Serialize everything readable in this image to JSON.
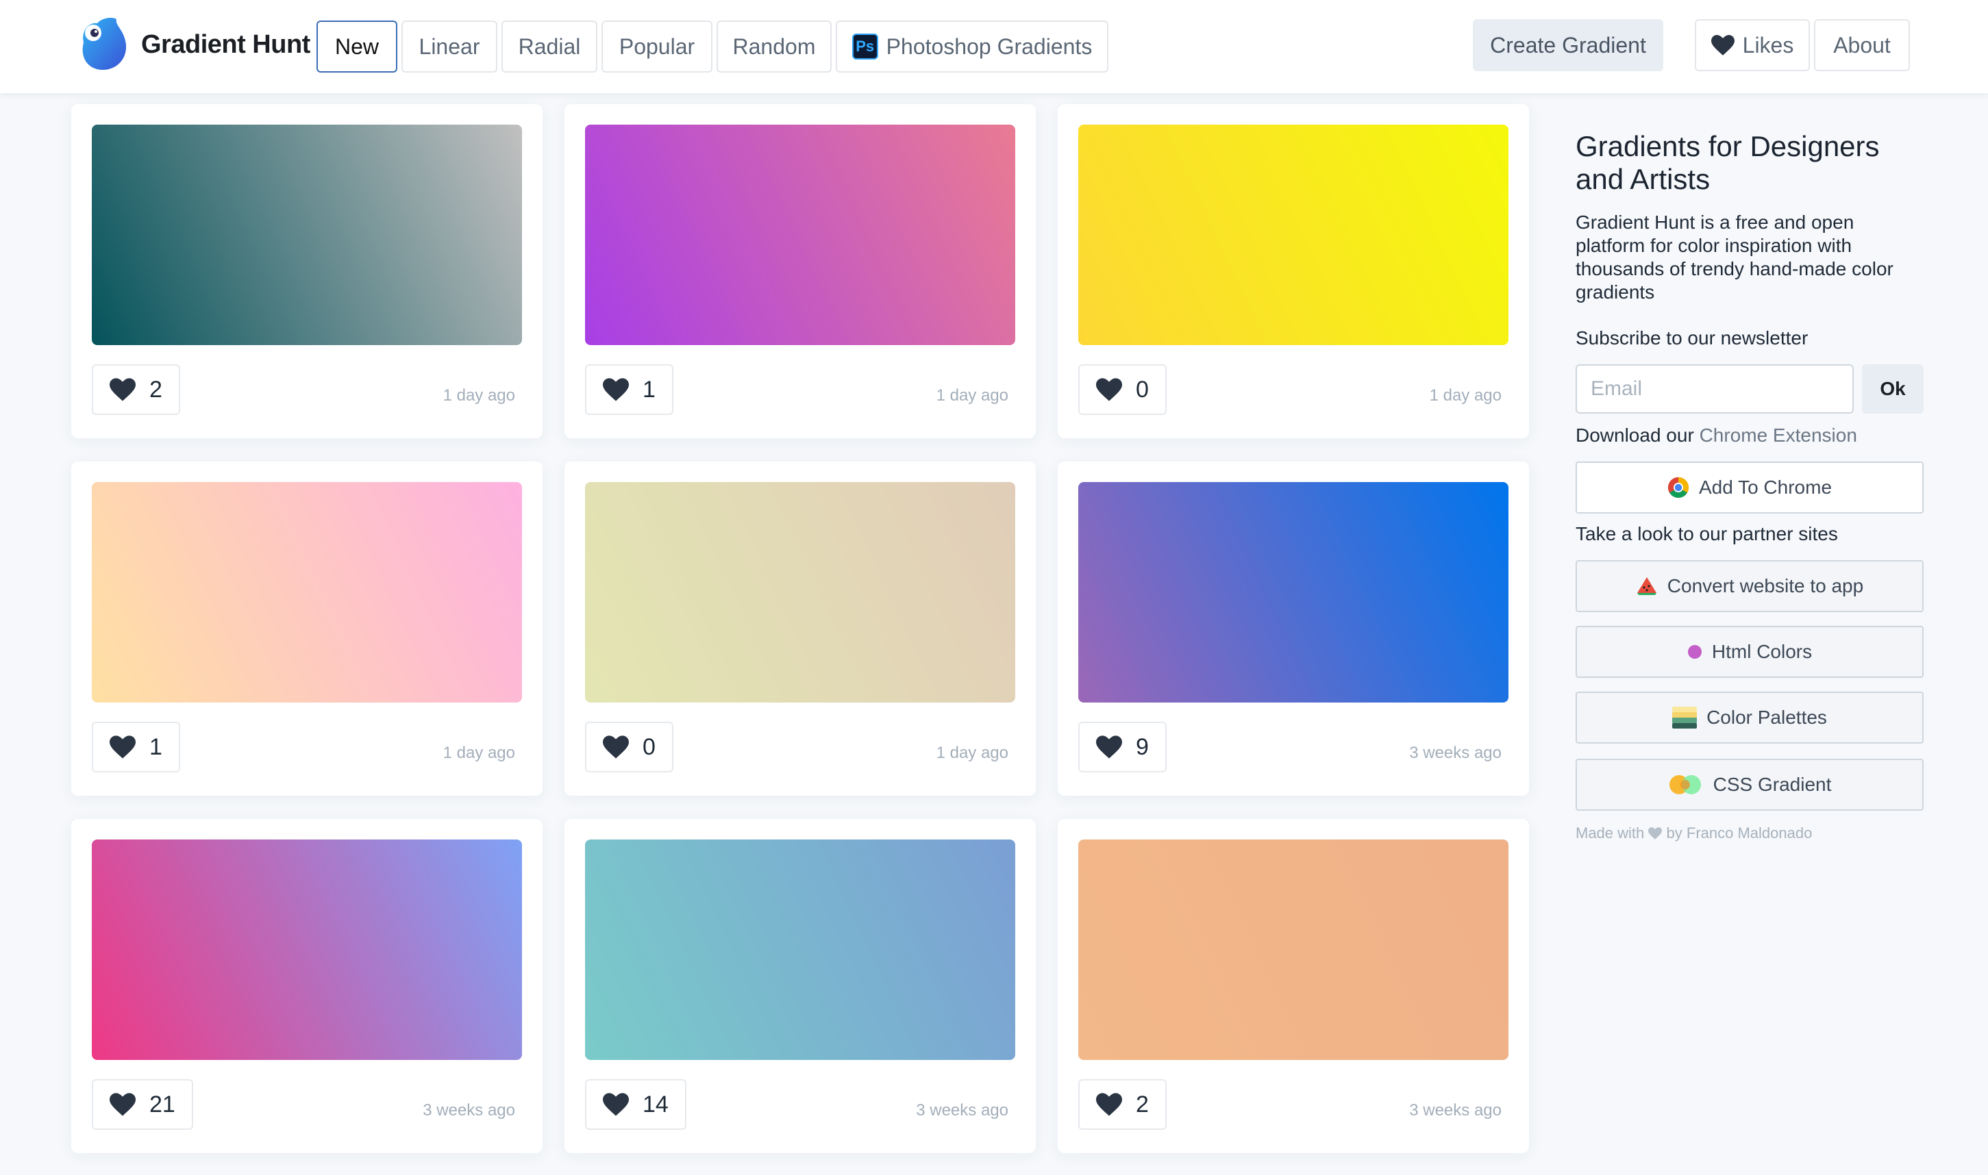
{
  "brand": {
    "name": "Gradient Hunt"
  },
  "nav": {
    "tabs": [
      {
        "label": "New",
        "active": true
      },
      {
        "label": "Linear"
      },
      {
        "label": "Radial"
      },
      {
        "label": "Popular"
      },
      {
        "label": "Random"
      },
      {
        "label": "Photoshop Gradients",
        "icon": "ps-icon",
        "icon_text": "Ps"
      }
    ],
    "create": "Create Gradient",
    "likes": "Likes",
    "about": "About"
  },
  "gradients": [
    {
      "likes": "2",
      "time": "1 day ago",
      "colors": [
        "#05535b",
        "#c1c0c0"
      ]
    },
    {
      "likes": "1",
      "time": "1 day ago",
      "colors": [
        "#a83fe6",
        "#e97b93"
      ]
    },
    {
      "likes": "0",
      "time": "1 day ago",
      "colors": [
        "#fdd835",
        "#f5f80b"
      ]
    },
    {
      "likes": "1",
      "time": "1 day ago",
      "colors": [
        "#ffe0a3",
        "#fdb1e0"
      ]
    },
    {
      "likes": "0",
      "time": "1 day ago",
      "colors": [
        "#e3e6b2",
        "#e1cdb9"
      ]
    },
    {
      "likes": "9",
      "time": "3 weeks ago",
      "colors": [
        "#9b67b8",
        "#0075ec"
      ]
    },
    {
      "likes": "21",
      "time": "3 weeks ago",
      "colors": [
        "#ee3985",
        "#7fa2f5"
      ]
    },
    {
      "likes": "14",
      "time": "3 weeks ago",
      "colors": [
        "#7acbc9",
        "#7b9fd4"
      ]
    },
    {
      "likes": "2",
      "time": "3 weeks ago",
      "colors": [
        "#f2b889",
        "#f0b088"
      ]
    }
  ],
  "sidebar": {
    "title": "Gradients for Designers and Artists",
    "description": "Gradient Hunt is a free and open platform for color inspiration with thousands of trendy hand-made color gradients",
    "newsletter_label": "Subscribe to our newsletter",
    "email_placeholder": "Email",
    "ok_label": "Ok",
    "download_prefix": "Download our",
    "download_link": "Chrome Extension",
    "chrome_button": "Add To Chrome",
    "partners_label": "Take a look to our partner sites",
    "partners": [
      {
        "label": "Convert website to app",
        "icon": "watermelon-icon"
      },
      {
        "label": "Html Colors",
        "icon": "dot-icon"
      },
      {
        "label": "Color Palettes",
        "icon": "palette-icon"
      },
      {
        "label": "CSS Gradient",
        "icon": "circles-icon"
      }
    ],
    "footer_prefix": "Made with",
    "footer_suffix": "by Franco Maldonado"
  }
}
